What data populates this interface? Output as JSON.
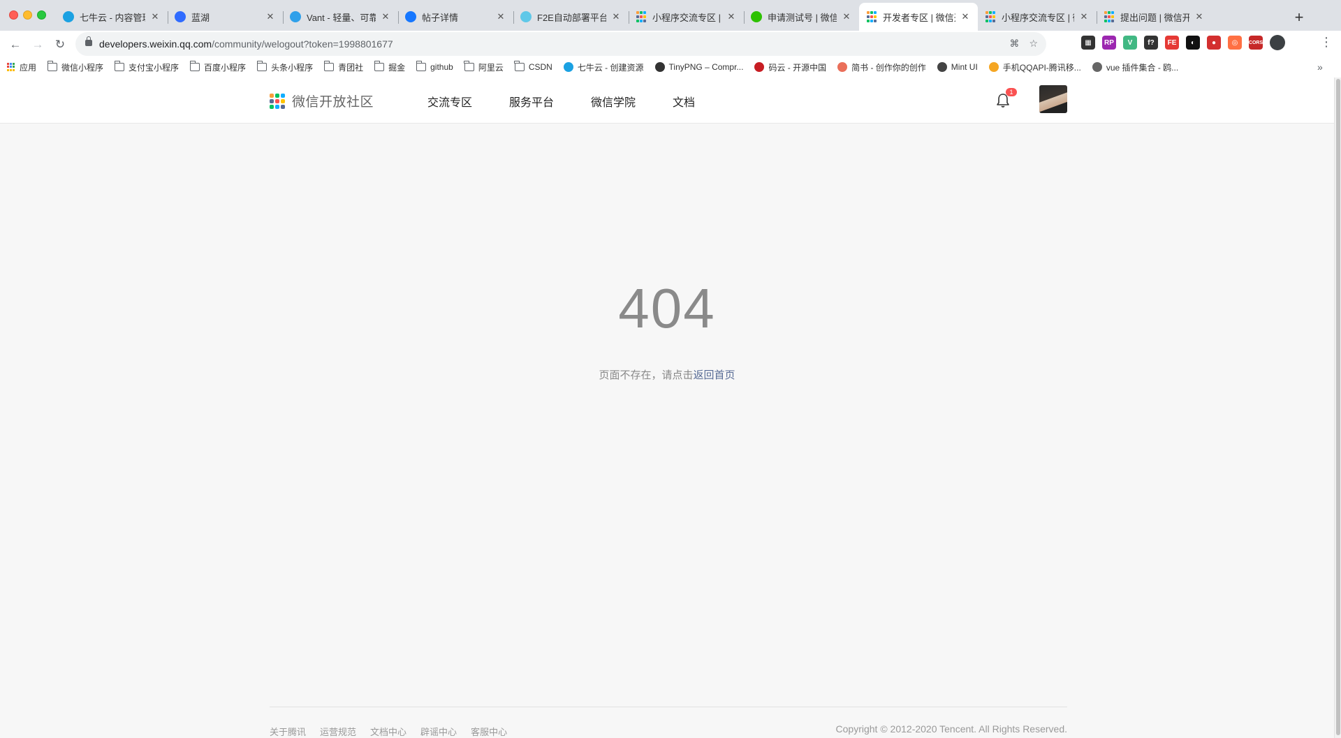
{
  "browser": {
    "tabs": [
      {
        "title": "七牛云 - 内容管理",
        "favicon_color": "#1ba1e2",
        "favicon": "qiniu-favicon"
      },
      {
        "title": "蓝湖",
        "favicon_color": "#2f6bff",
        "favicon": "lanhu-favicon"
      },
      {
        "title": "Vant - 轻量、可靠的",
        "favicon_color": "#2fa0ea",
        "favicon": "vant-favicon"
      },
      {
        "title": "帖子详情",
        "favicon_color": "#1677ff",
        "favicon": "alipay-favicon"
      },
      {
        "title": "F2E自动部署平台",
        "favicon_color": "#5fc8e8",
        "favicon": "react-favicon"
      },
      {
        "title": "小程序交流专区 | 微",
        "favicon_color": "#07c160",
        "favicon": "wx-dev-favicon"
      },
      {
        "title": "申请测试号 | 微信开",
        "favicon_color": "#2dc100",
        "favicon": "wechat-favicon"
      },
      {
        "title": "开发者专区 | 微信开",
        "favicon_color": "#07c160",
        "favicon": "wx-dev-favicon",
        "active": true
      },
      {
        "title": "小程序交流专区 | 微",
        "favicon_color": "#07c160",
        "favicon": "wx-dev-favicon"
      },
      {
        "title": "提出问题 | 微信开放",
        "favicon_color": "#07c160",
        "favicon": "wx-dev-favicon"
      }
    ],
    "close_glyph": "✕",
    "new_tab_glyph": "+",
    "url_host": "developers.weixin.qq.com",
    "url_path": "/community/welogout?token=1998801677",
    "extensions": [
      {
        "label": "▦",
        "color": "#333333",
        "name": "qr-extension-icon"
      },
      {
        "label": "RP",
        "color": "#9c27b0",
        "name": "rp-extension-icon"
      },
      {
        "label": "V",
        "color": "#41b883",
        "name": "vue-devtools-icon"
      },
      {
        "label": "f?",
        "color": "#333333",
        "name": "function-extension-icon"
      },
      {
        "label": "FE",
        "color": "#e53935",
        "name": "fehelper-extension-icon"
      },
      {
        "label": "◐",
        "color": "#111111",
        "name": "dark-extension-icon"
      },
      {
        "label": "●",
        "color": "#d32f2f",
        "name": "red-extension-icon"
      },
      {
        "label": "◎",
        "color": "#ff7043",
        "name": "orange-extension-icon"
      },
      {
        "label": "CORS",
        "color": "#c62828",
        "name": "cors-extension-icon"
      }
    ],
    "bookmarks": [
      {
        "label": "应用",
        "type": "apps"
      },
      {
        "label": "微信小程序",
        "type": "folder"
      },
      {
        "label": "支付宝小程序",
        "type": "folder"
      },
      {
        "label": "百度小程序",
        "type": "folder"
      },
      {
        "label": "头条小程序",
        "type": "folder"
      },
      {
        "label": "青团社",
        "type": "folder"
      },
      {
        "label": "掘金",
        "type": "folder"
      },
      {
        "label": "github",
        "type": "folder"
      },
      {
        "label": "阿里云",
        "type": "folder"
      },
      {
        "label": "CSDN",
        "type": "folder"
      },
      {
        "label": "七牛云 - 创建资源",
        "type": "site",
        "color": "#1ba1e2"
      },
      {
        "label": "TinyPNG – Compr...",
        "type": "site",
        "color": "#333333"
      },
      {
        "label": "码云 - 开源中国",
        "type": "site",
        "color": "#c71d23"
      },
      {
        "label": "简书 - 创作你的创作",
        "type": "site",
        "color": "#ea6f5a"
      },
      {
        "label": "Mint UI",
        "type": "site",
        "color": "#444444"
      },
      {
        "label": "手机QQAPI-腾讯移...",
        "type": "site",
        "color": "#f5a623"
      },
      {
        "label": "vue 插件集合 - 鸥...",
        "type": "site",
        "color": "#666666"
      }
    ],
    "bookmarks_more": "»"
  },
  "site": {
    "logo_text": "微信开放社区",
    "logo_colors": [
      "#fa9d3b",
      "#07c160",
      "#10aeff",
      "#576b95",
      "#fa5151",
      "#ffc300",
      "#07c160",
      "#10aeff",
      "#576b95"
    ],
    "nav": [
      "交流专区",
      "服务平台",
      "微信学院",
      "文档"
    ],
    "notification_count": "1"
  },
  "error": {
    "code": "404",
    "message_prefix": "页面不存在，请点击",
    "home_link": "返回首页"
  },
  "footer": {
    "links": [
      "关于腾讯",
      "运营规范",
      "文档中心",
      "辟谣中心",
      "客服中心"
    ],
    "copyright": "Copyright © 2012-2020 Tencent. All Rights Reserved."
  }
}
